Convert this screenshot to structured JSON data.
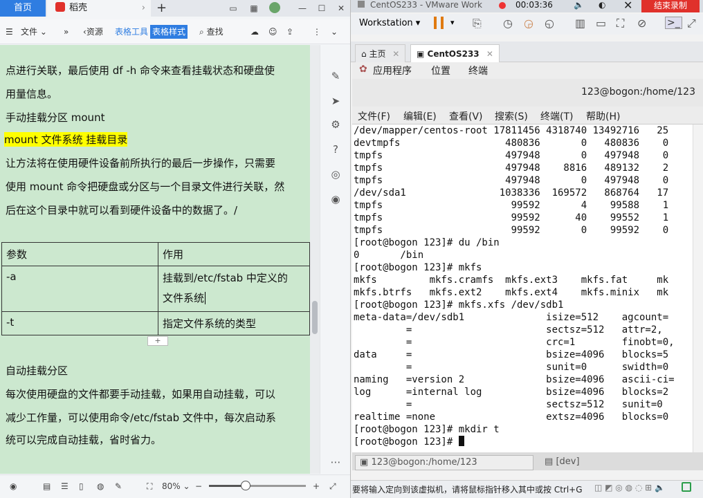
{
  "wps": {
    "tabs": {
      "home": "首页",
      "doc": "稻壳"
    },
    "toolbar": {
      "file": "文件",
      "resources": "资源",
      "table_tools": "表格工具",
      "table_style": "表格样式",
      "search": "查找"
    },
    "doc_lines": [
      "点进行关联，最后使用 df -h 命令来查看挂载状态和硬盘使",
      "用量信息。",
      "手动挂载分区 mount",
      "mount 文件系统 挂载目录",
      "让方法将在使用硬件设备前所执行的最后一步操作，只需要",
      "使用 mount 命令把硬盘或分区与一个目录文件进行关联，然",
      "后在这个目录中就可以看到硬件设备中的数据了。/"
    ],
    "table": {
      "header": [
        "参数",
        "作用"
      ],
      "rows": [
        [
          "-a",
          "挂载到/etc/fstab 中定义的",
          "文件系统"
        ],
        [
          "-t",
          "指定文件系统的类型"
        ]
      ]
    },
    "doc_lines2": [
      "自动挂载分区",
      "每次使用硬盘的文件都要手动挂载，如果用自动挂载，可以",
      "减少工作量，可以使用命令/etc/fstab 文件中，每次启动系",
      "统可以完成自动挂载，省时省力。"
    ],
    "status": {
      "zoom": "80%",
      "zoom_fraction": 0.38
    }
  },
  "vm": {
    "title": "CentOS233 - VMware Work",
    "timer": "00:03:36",
    "record_btn": "结束录制",
    "menu_workstation": "Workstation",
    "tabs": {
      "home": "主页",
      "vm": "CentOS233"
    },
    "gnome": {
      "apps": "应用程序",
      "places": "位置",
      "terminal": "终端"
    },
    "term_title": "123@bogon:/home/123",
    "term_menu": [
      "文件(F)",
      "编辑(E)",
      "查看(V)",
      "搜索(S)",
      "终端(T)",
      "帮助(H)"
    ],
    "terminal_text": "/dev/mapper/centos-root 17811456 4318740 13492716   25\ndevtmpfs                  480836       0   480836    0\ntmpfs                     497948       0   497948    0\ntmpfs                     497948    8816   489132    2\ntmpfs                     497948       0   497948    0\n/dev/sda1                1038336  169572   868764   17\ntmpfs                      99592       4    99588    1\ntmpfs                      99592      40    99552    1\ntmpfs                      99592       0    99592    0\n[root@bogon 123]# du /bin\n0       /bin\n[root@bogon 123]# mkfs\nmkfs         mkfs.cramfs  mkfs.ext3    mkfs.fat     mk\nmkfs.btrfs   mkfs.ext2    mkfs.ext4    mkfs.minix   mk\n[root@bogon 123]# mkfs.xfs /dev/sdb1\nmeta-data=/dev/sdb1              isize=512    agcount=\n         =                       sectsz=512   attr=2, \n         =                       crc=1        finobt=0,\ndata     =                       bsize=4096   blocks=5\n         =                       sunit=0      swidth=0\nnaming   =version 2              bsize=4096   ascii-ci=\nlog      =internal log           bsize=4096   blocks=2\n         =                       sectsz=512   sunit=0 \nrealtime =none                   extsz=4096   blocks=0\n[root@bogon 123]# mkdir t\n[root@bogon 123]# ",
    "term_tabs": {
      "t1": "123@bogon:/home/123",
      "t2": "[dev]"
    },
    "status": "要将输入定向到该虚拟机，请将鼠标指针移入其中或按 Ctrl+G"
  }
}
